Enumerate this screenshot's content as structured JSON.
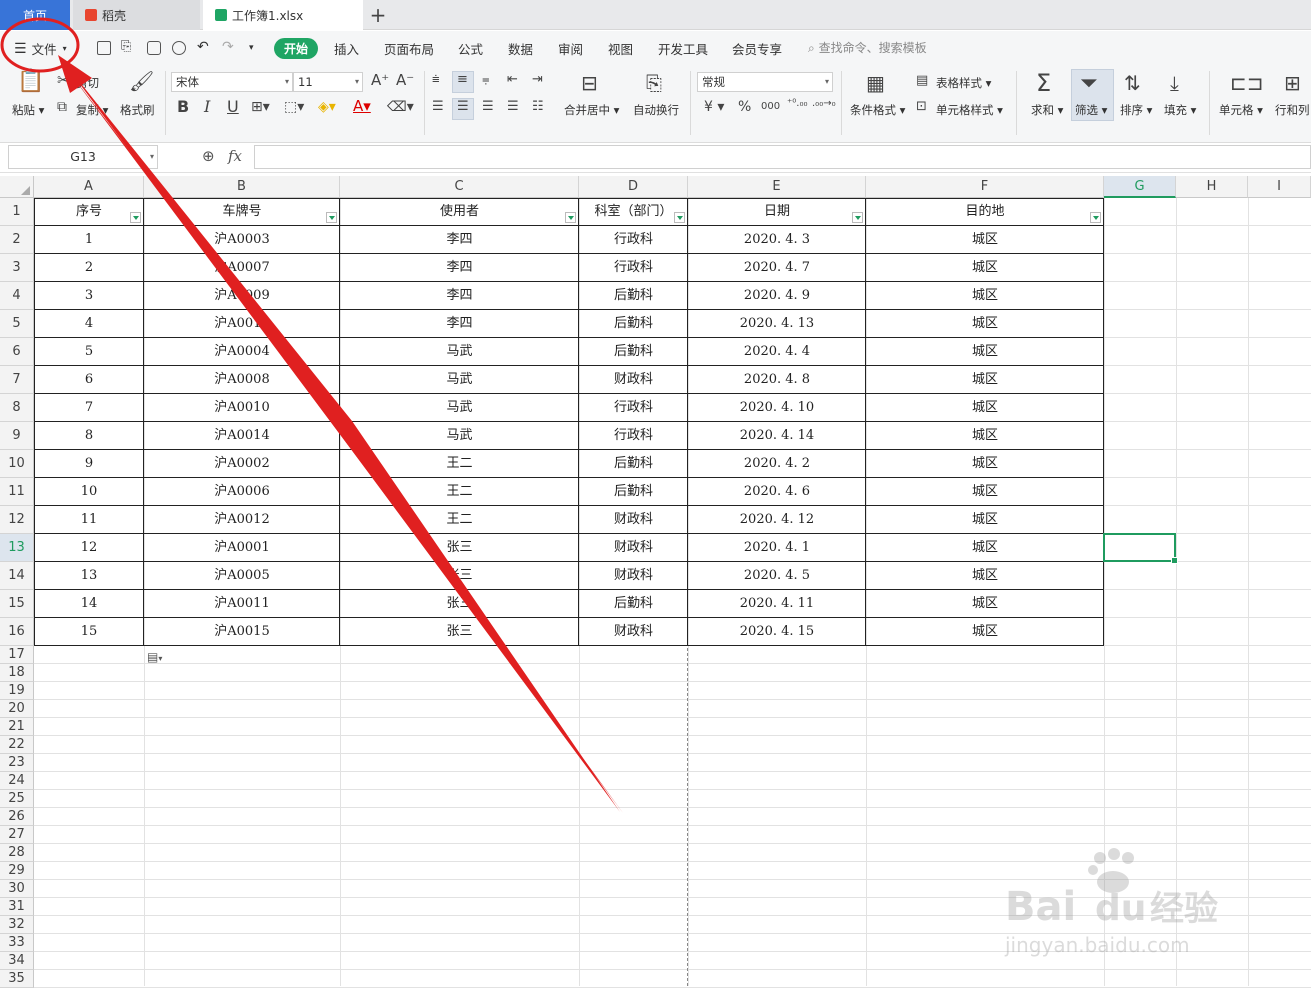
{
  "tabs": [
    {
      "label": "首页",
      "active": false
    },
    {
      "label": "稻壳",
      "active": false,
      "icon": "docer-icon",
      "color": "#e8452f"
    },
    {
      "label": "工作簿1.xlsx",
      "active": true,
      "icon": "spreadsheet-icon",
      "color": "#1fa564"
    }
  ],
  "menu": {
    "file": "文件",
    "items": [
      "开始",
      "插入",
      "页面布局",
      "公式",
      "数据",
      "审阅",
      "视图",
      "开发工具",
      "会员专享"
    ],
    "search_placeholder": "查找命令、搜索模板"
  },
  "ribbon": {
    "paste": "粘贴",
    "cut": "剪切",
    "copy": "复制",
    "format_painter": "格式刷",
    "font_name": "宋体",
    "font_size": "11",
    "bold": "B",
    "italic": "I",
    "underline": "U",
    "merge_center": "合并居中",
    "wrap_text": "自动换行",
    "number_format": "常规",
    "currency": "¥",
    "percent": "%",
    "thousands": "000",
    "cond_format": "条件格式",
    "table_style": "表格样式",
    "cell_style": "单元格样式",
    "sum": "求和",
    "filter": "筛选",
    "sort": "排序",
    "fill": "填充",
    "cell": "单元格",
    "row_col": "行和列"
  },
  "formula_bar": {
    "name_box": "G13",
    "fx": "fx",
    "content": ""
  },
  "columns": [
    "A",
    "B",
    "C",
    "D",
    "E",
    "F",
    "G",
    "H",
    "I"
  ],
  "selected": {
    "column": "G",
    "row": 13
  },
  "table": {
    "headers": [
      "序号",
      "车牌号",
      "使用者",
      "科室（部门）",
      "日期",
      "目的地"
    ],
    "rows": [
      [
        "1",
        "沪A0003",
        "李四",
        "行政科",
        "2020. 4. 3",
        "城区"
      ],
      [
        "2",
        "沪A0007",
        "李四",
        "行政科",
        "2020. 4. 7",
        "城区"
      ],
      [
        "3",
        "沪A0009",
        "李四",
        "后勤科",
        "2020. 4. 9",
        "城区"
      ],
      [
        "4",
        "沪A0013",
        "李四",
        "后勤科",
        "2020. 4. 13",
        "城区"
      ],
      [
        "5",
        "沪A0004",
        "马武",
        "后勤科",
        "2020. 4. 4",
        "城区"
      ],
      [
        "6",
        "沪A0008",
        "马武",
        "财政科",
        "2020. 4. 8",
        "城区"
      ],
      [
        "7",
        "沪A0010",
        "马武",
        "行政科",
        "2020. 4. 10",
        "城区"
      ],
      [
        "8",
        "沪A0014",
        "马武",
        "行政科",
        "2020. 4. 14",
        "城区"
      ],
      [
        "9",
        "沪A0002",
        "王二",
        "后勤科",
        "2020. 4. 2",
        "城区"
      ],
      [
        "10",
        "沪A0006",
        "王二",
        "后勤科",
        "2020. 4. 6",
        "城区"
      ],
      [
        "11",
        "沪A0012",
        "王二",
        "财政科",
        "2020. 4. 12",
        "城区"
      ],
      [
        "12",
        "沪A0001",
        "张三",
        "财政科",
        "2020. 4. 1",
        "城区"
      ],
      [
        "13",
        "沪A0005",
        "张三",
        "财政科",
        "2020. 4. 5",
        "城区"
      ],
      [
        "14",
        "沪A0011",
        "张三",
        "后勤科",
        "2020. 4. 11",
        "城区"
      ],
      [
        "15",
        "沪A0015",
        "张三",
        "财政科",
        "2020. 4. 15",
        "城区"
      ]
    ]
  },
  "row_count": 35,
  "watermark": {
    "line1": "Bai",
    "line2": "du",
    "line3": "经验",
    "url": "jingyan.baidu.com"
  },
  "colors": {
    "accent": "#1fa564",
    "annotation": "#e02020",
    "home_tab": "#3874d8"
  }
}
